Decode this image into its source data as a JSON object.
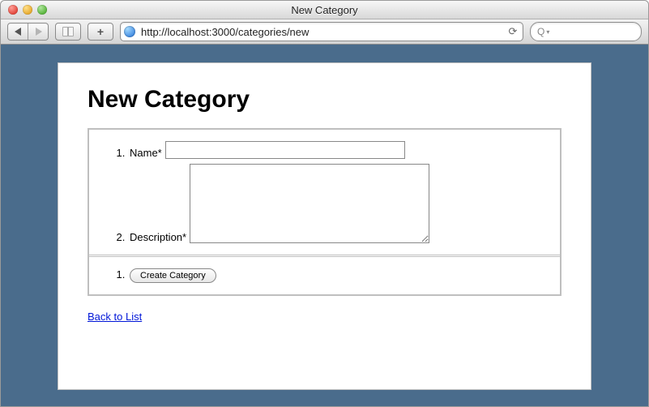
{
  "window": {
    "title": "New Category"
  },
  "toolbar": {
    "url": "http://localhost:3000/categories/new",
    "search_placeholder": ""
  },
  "page": {
    "heading": "New Category",
    "form": {
      "fields": {
        "name": {
          "label": "Name*",
          "value": ""
        },
        "description": {
          "label": "Description*",
          "value": ""
        }
      },
      "submit_label": "Create Category"
    },
    "back_link_label": "Back to List"
  }
}
